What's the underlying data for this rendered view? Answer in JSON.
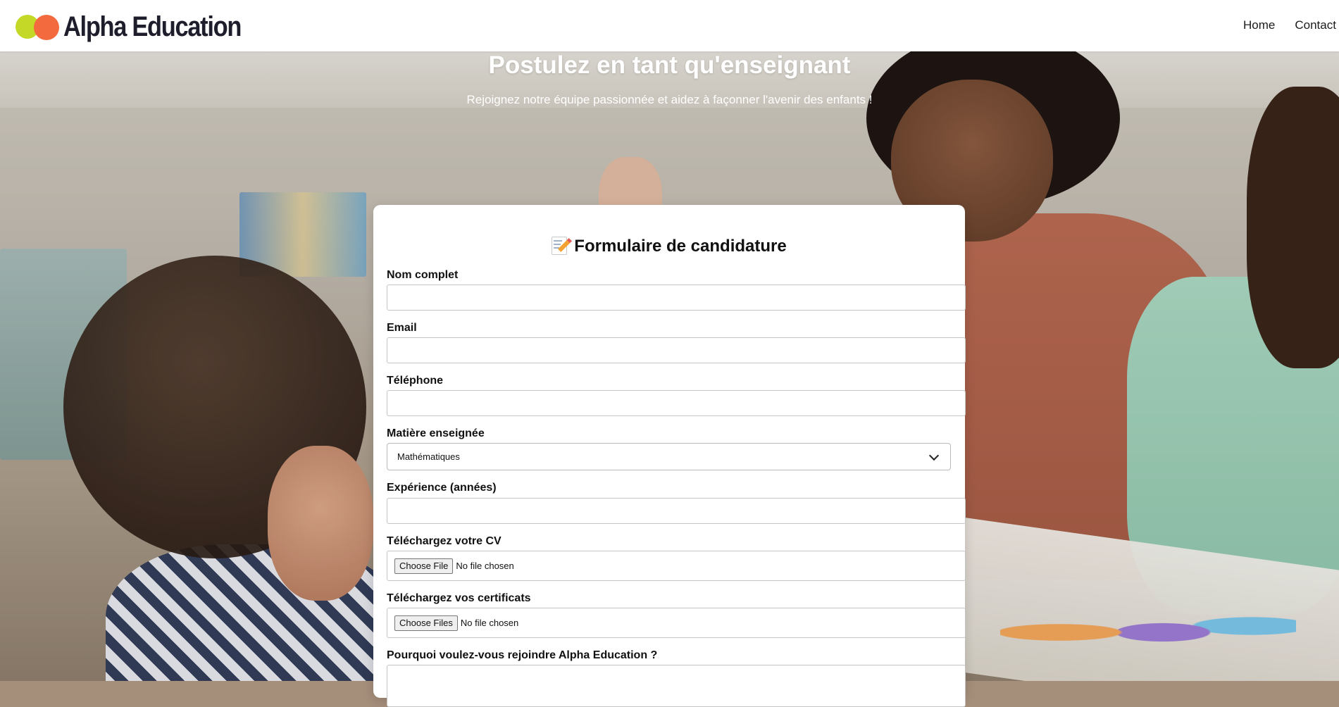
{
  "brand": {
    "name": "Alpha Education",
    "colors": {
      "dot_green": "#c4d927",
      "dot_orange": "#f26a3d",
      "text": "#1d1d2c"
    }
  },
  "nav": {
    "items": [
      {
        "label": "Home"
      },
      {
        "label": "Contact u"
      }
    ]
  },
  "hero": {
    "title": "Postulez en tant qu'enseignant",
    "subtitle": "Rejoignez notre équipe passionnée et aidez à façonner l'avenir des enfants !"
  },
  "form": {
    "title_icon": "memo-icon",
    "title": "Formulaire de candidature",
    "fields": {
      "name": {
        "label": "Nom complet",
        "value": ""
      },
      "email": {
        "label": "Email",
        "value": ""
      },
      "phone": {
        "label": "Téléphone",
        "value": ""
      },
      "subject": {
        "label": "Matière enseignée",
        "selected": "Mathématiques"
      },
      "experience": {
        "label": "Expérience (années)",
        "value": ""
      },
      "cv": {
        "label": "Téléchargez votre CV",
        "button": "Choose File",
        "status": "No file chosen"
      },
      "certificates": {
        "label": "Téléchargez vos certificats",
        "button": "Choose Files",
        "status": "No file chosen"
      },
      "motivation": {
        "label": "Pourquoi voulez-vous rejoindre Alpha Education ?",
        "value": ""
      }
    }
  }
}
